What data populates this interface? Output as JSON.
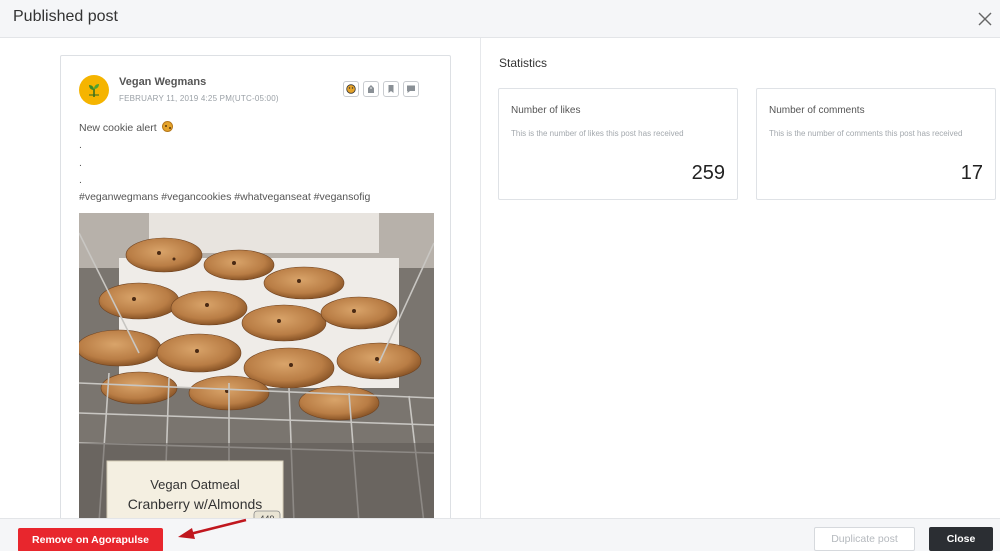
{
  "header": {
    "title": "Published post",
    "close_icon": "close-icon"
  },
  "post": {
    "account_name": "Vegan Wegmans",
    "date": "FEBRUARY 11, 2019 4:25 PM(UTC-05:00)",
    "actions": [
      "emoji-icon",
      "tag-icon",
      "bookmark-icon",
      "comment-icon"
    ],
    "caption_lines": [
      "New cookie alert",
      ".",
      ".",
      ".",
      "#veganwegmans #vegancookies #whatveganseat #vegansofig"
    ],
    "image_label": {
      "line1": "Vegan Oatmeal",
      "line2": "Cranberry w/Almonds",
      "price_tag": "449"
    }
  },
  "statistics": {
    "title": "Statistics",
    "cards": [
      {
        "label": "Number of likes",
        "description": "This is the number of likes this post has received",
        "value": "259"
      },
      {
        "label": "Number of comments",
        "description": "This is the number of comments this post has received",
        "value": "17"
      }
    ]
  },
  "footer": {
    "remove_label": "Remove on Agorapulse",
    "duplicate_label": "Duplicate post",
    "close_label": "Close"
  },
  "colors": {
    "danger": "#e8262d",
    "dark": "#2b2e33",
    "annotation_arrow": "#c0171e"
  }
}
